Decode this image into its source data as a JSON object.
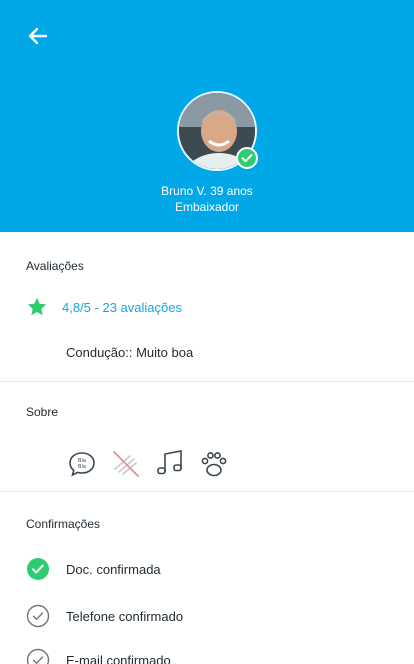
{
  "header": {
    "back_icon": "arrow-left-icon",
    "name": "Bruno V. 39 anos",
    "role": "Embaixador",
    "colors": {
      "background": "#00a8e8",
      "verified": "#2ecc71"
    }
  },
  "ratings": {
    "title": "Avaliações",
    "icon": "star-icon",
    "summary": "4,8/5 - 23 avaliações",
    "driving": "Condução:: Muito boa",
    "colors": {
      "star": "#2ecc71",
      "link": "#1aa6d8"
    }
  },
  "about": {
    "title": "Sobre",
    "icons": [
      {
        "name": "chat-bubble-icon",
        "text": "Bla Bla"
      },
      {
        "name": "no-smoking-icon"
      },
      {
        "name": "music-note-icon"
      },
      {
        "name": "paw-icon"
      }
    ]
  },
  "confirmations": {
    "title": "Confirmações",
    "items": [
      {
        "label": "Doc. confirmada",
        "state": "confirmed"
      },
      {
        "label": "Telefone confirmado",
        "state": "outline"
      },
      {
        "label": "E-mail confirmado",
        "state": "outline"
      }
    ]
  }
}
